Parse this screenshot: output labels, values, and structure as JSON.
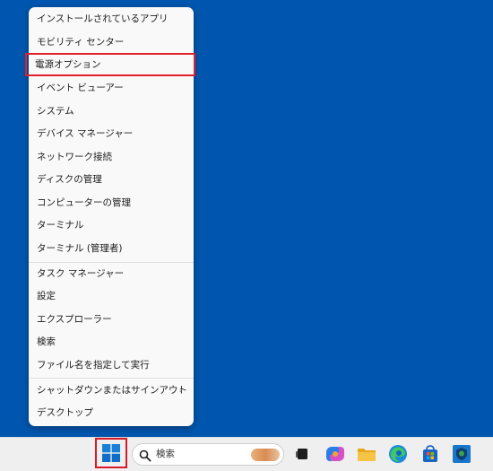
{
  "context_menu": {
    "items": [
      "インストールされているアプリ",
      "モビリティ センター",
      "電源オプション",
      "イベント ビューアー",
      "システム",
      "デバイス マネージャー",
      "ネットワーク接続",
      "ディスクの管理",
      "コンピューターの管理",
      "ターミナル",
      "ターミナル (管理者)",
      "タスク マネージャー",
      "設定",
      "エクスプローラー",
      "検索",
      "ファイル名を指定して実行",
      "シャットダウンまたはサインアウト",
      "デスクトップ"
    ],
    "submenu_chevron": "›"
  },
  "taskbar": {
    "search_placeholder": "検索",
    "icons": [
      "start-icon",
      "task-view-icon",
      "copilot-icon",
      "file-explorer-icon",
      "edge-icon",
      "store-icon",
      "security-icon"
    ]
  },
  "colors": {
    "desktop": "#0056ae",
    "highlight": "#e0202a",
    "menu_bg": "#f9f9f9",
    "taskbar_bg": "#efefef"
  }
}
